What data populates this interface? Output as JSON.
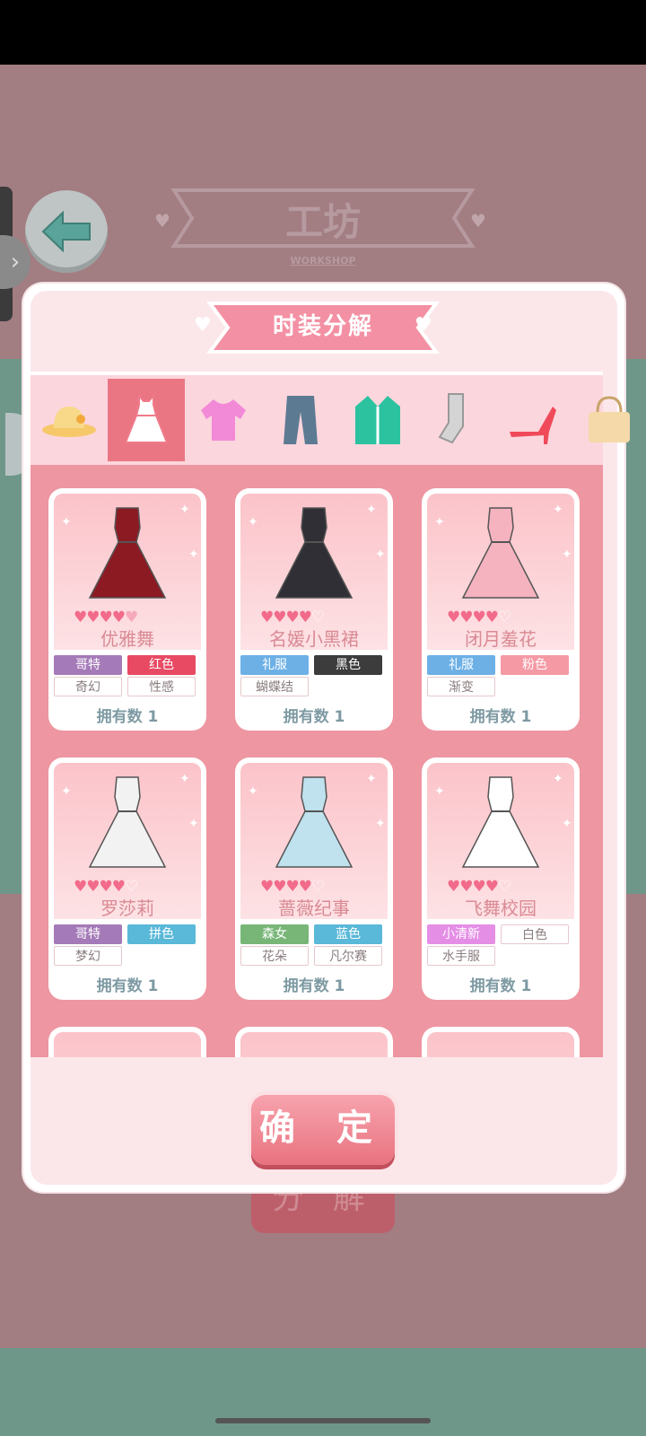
{
  "workshop": {
    "title": "工坊",
    "subtitle": "WORKSHOP",
    "decompose_button": "分 解"
  },
  "panel": {
    "title": "时装分解",
    "confirm_button": "确 定"
  },
  "categories": [
    {
      "icon": "hat-icon",
      "active": false
    },
    {
      "icon": "dress-icon",
      "active": true
    },
    {
      "icon": "top-icon",
      "active": false
    },
    {
      "icon": "pants-icon",
      "active": false
    },
    {
      "icon": "coat-icon",
      "active": false
    },
    {
      "icon": "socks-icon",
      "active": false
    },
    {
      "icon": "heels-icon",
      "active": false
    },
    {
      "icon": "bag-icon",
      "active": false
    }
  ],
  "items": [
    {
      "name": "优雅舞",
      "stars": 4.5,
      "tags": [
        {
          "text": "哥特",
          "color": "#a57ab8"
        },
        {
          "text": "红色",
          "color": "#e84a63"
        },
        {
          "text": "奇幻",
          "outline": true
        },
        {
          "text": "性感",
          "outline": true
        }
      ],
      "owned_label": "拥有数",
      "owned": "1",
      "dress_color": "#8b1a23"
    },
    {
      "name": "名媛小黑裙",
      "stars": 4,
      "tags": [
        {
          "text": "礼服",
          "color": "#6db0e6"
        },
        {
          "text": "黑色",
          "color": "#3c3c3c"
        },
        {
          "text": "蝴蝶结",
          "outline": true
        }
      ],
      "owned_label": "拥有数",
      "owned": "1",
      "dress_color": "#2f2f35"
    },
    {
      "name": "闭月羞花",
      "stars": 4,
      "tags": [
        {
          "text": "礼服",
          "color": "#6db0e6"
        },
        {
          "text": "粉色",
          "color": "#f59aa4"
        },
        {
          "text": "渐变",
          "outline": true
        }
      ],
      "owned_label": "拥有数",
      "owned": "1",
      "dress_color": "#f5b3bf"
    },
    {
      "name": "罗莎莉",
      "stars": 4,
      "tags": [
        {
          "text": "哥特",
          "color": "#a57ab8"
        },
        {
          "text": "拼色",
          "color": "#5ab8d8"
        },
        {
          "text": "梦幻",
          "outline": true
        }
      ],
      "owned_label": "拥有数",
      "owned": "1",
      "dress_color": "#f2f2f2"
    },
    {
      "name": "蔷薇纪事",
      "stars": 4,
      "tags": [
        {
          "text": "森女",
          "color": "#78b678"
        },
        {
          "text": "蓝色",
          "color": "#5ab8d8"
        },
        {
          "text": "花朵",
          "outline": true
        },
        {
          "text": "凡尔赛",
          "outline": true
        }
      ],
      "owned_label": "拥有数",
      "owned": "1",
      "dress_color": "#bfe2ee"
    },
    {
      "name": "飞舞校园",
      "stars": 4,
      "tags": [
        {
          "text": "小清新",
          "color": "#e58ee6"
        },
        {
          "text": "白色",
          "outline": true
        },
        {
          "text": "水手服",
          "outline": true
        }
      ],
      "owned_label": "拥有数",
      "owned": "1",
      "dress_color": "#ffffff"
    }
  ]
}
